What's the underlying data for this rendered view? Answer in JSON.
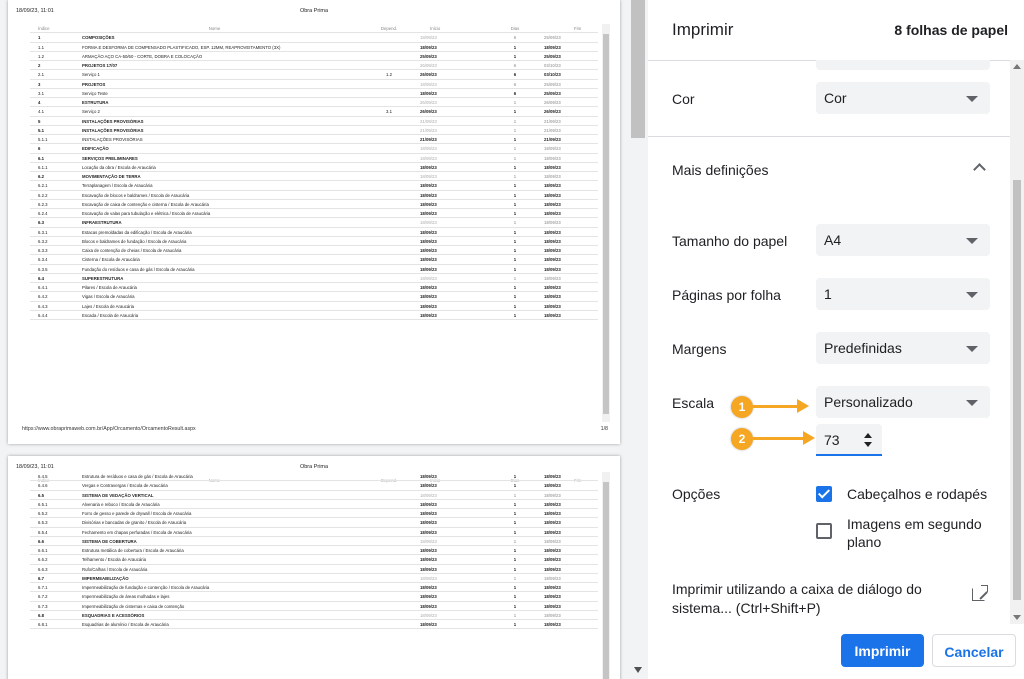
{
  "preview": {
    "page1": {
      "date": "18/09/23, 11:01",
      "title": "Obra Prima",
      "url": "https://www.obraprimaweb.com.br/App/Orcamento/OrcamentoResult.aspx",
      "page_num": "1/8",
      "headers": [
        "Índice",
        "Nome",
        "Depend.",
        "Início",
        "Dias",
        "Fim"
      ],
      "rows": [
        {
          "idx": "1",
          "name": "COMPOSIÇÕES",
          "dep": "",
          "start": "18/09/23",
          "days": "6",
          "end": "25/09/23",
          "style": "bold muted"
        },
        {
          "idx": "1.1",
          "name": "FORMA E DESFORMA DE COMPENSADO PLASTIFICADO, ESP. 12MM, REAPROVEITAMENTO (3X)",
          "dep": "",
          "start": "18/09/23",
          "days": "1",
          "end": "18/09/23",
          "style": "strong"
        },
        {
          "idx": "1.2",
          "name": "ARMAÇÃO AÇO CA-50/60 - CORTE, DOBRA E COLOCAÇÃO",
          "dep": "",
          "start": "25/09/23",
          "days": "1",
          "end": "25/09/23",
          "style": "strong"
        },
        {
          "idx": "2",
          "name": "PROJETOS 17/07",
          "dep": "",
          "start": "26/09/23",
          "days": "6",
          "end": "03/10/23",
          "style": "bold muted"
        },
        {
          "idx": "2.1",
          "name": "Serviço 1",
          "dep": "1.2",
          "start": "26/09/23",
          "days": "6",
          "end": "03/10/23",
          "style": "strong"
        },
        {
          "idx": "3",
          "name": "PROJETOS",
          "dep": "",
          "start": "18/09/23",
          "days": "6",
          "end": "25/09/23",
          "style": "bold muted"
        },
        {
          "idx": "3.1",
          "name": "Serviço Teste",
          "dep": "",
          "start": "18/09/23",
          "days": "6",
          "end": "25/09/23",
          "style": "strong"
        },
        {
          "idx": "4",
          "name": "ESTRUTURA",
          "dep": "",
          "start": "26/09/23",
          "days": "1",
          "end": "26/09/23",
          "style": "bold muted"
        },
        {
          "idx": "4.1",
          "name": "Serviço 2",
          "dep": "3.1",
          "start": "26/09/23",
          "days": "1",
          "end": "26/09/23",
          "style": "strong"
        },
        {
          "idx": "5",
          "name": "INSTALAÇÕES PROVISÓRIAS",
          "dep": "",
          "start": "21/09/23",
          "days": "1",
          "end": "21/09/23",
          "style": "bold muted"
        },
        {
          "idx": "5.1",
          "name": "INSTALAÇÕES PROVISÓRIAS",
          "dep": "",
          "start": "21/09/23",
          "days": "1",
          "end": "21/09/23",
          "style": "bold muted"
        },
        {
          "idx": "5.1.1",
          "name": "INSTALAÇÕES PROVISÓRIAS",
          "dep": "",
          "start": "21/09/23",
          "days": "1",
          "end": "21/09/23",
          "style": "strong"
        },
        {
          "idx": "6",
          "name": "EDIFICAÇÃO",
          "dep": "",
          "start": "18/09/23",
          "days": "1",
          "end": "18/09/23",
          "style": "bold muted"
        },
        {
          "idx": "6.1",
          "name": "SERVIÇOS PRELIMINARES",
          "dep": "",
          "start": "18/09/23",
          "days": "1",
          "end": "18/09/23",
          "style": "bold muted"
        },
        {
          "idx": "6.1.1",
          "name": "Locação da obra / Escola de Araucária",
          "dep": "",
          "start": "18/09/23",
          "days": "1",
          "end": "18/09/23",
          "style": "strong"
        },
        {
          "idx": "6.2",
          "name": "MOVIMENTAÇÃO DE TERRA",
          "dep": "",
          "start": "18/09/23",
          "days": "1",
          "end": "18/09/23",
          "style": "bold muted"
        },
        {
          "idx": "6.2.1",
          "name": "Terraplanagem / Escola de Araucária",
          "dep": "",
          "start": "18/09/23",
          "days": "1",
          "end": "18/09/23",
          "style": "strong"
        },
        {
          "idx": "6.2.2",
          "name": "Escavação de blocos e baldrames / Escola de Araucária",
          "dep": "",
          "start": "18/09/23",
          "days": "1",
          "end": "18/09/23",
          "style": "strong"
        },
        {
          "idx": "6.2.3",
          "name": "Escavação de caixa de contenção e cisterna / Escola de Araucária",
          "dep": "",
          "start": "18/09/23",
          "days": "1",
          "end": "18/09/23",
          "style": "strong"
        },
        {
          "idx": "6.2.4",
          "name": "Escavação de valas para tubulação e elétrica / Escola de Araucária",
          "dep": "",
          "start": "18/09/23",
          "days": "1",
          "end": "18/09/23",
          "style": "strong"
        },
        {
          "idx": "6.3",
          "name": "INFRAESTRUTURA",
          "dep": "",
          "start": "18/09/23",
          "days": "1",
          "end": "18/09/23",
          "style": "bold muted"
        },
        {
          "idx": "6.3.1",
          "name": "Estacas premoldadas da edificação / Escola de Araucária",
          "dep": "",
          "start": "18/09/23",
          "days": "1",
          "end": "18/09/23",
          "style": "strong"
        },
        {
          "idx": "6.3.2",
          "name": "Blocos e baldrames de fundação / Escola de Araucária",
          "dep": "",
          "start": "18/09/23",
          "days": "1",
          "end": "18/09/23",
          "style": "strong"
        },
        {
          "idx": "6.3.3",
          "name": "Caixa de contenção de cheias / Escola de Araucária",
          "dep": "",
          "start": "18/09/23",
          "days": "1",
          "end": "18/09/23",
          "style": "strong"
        },
        {
          "idx": "6.3.4",
          "name": "Cisterna / Escola de Araucária",
          "dep": "",
          "start": "18/09/23",
          "days": "1",
          "end": "18/09/23",
          "style": "strong"
        },
        {
          "idx": "6.3.5",
          "name": "Fundação do resíduos e casa de gás / Escola de Araucária",
          "dep": "",
          "start": "18/09/23",
          "days": "1",
          "end": "18/09/23",
          "style": "strong"
        },
        {
          "idx": "6.4",
          "name": "SUPERESTRUTURA",
          "dep": "",
          "start": "18/09/23",
          "days": "1",
          "end": "18/09/23",
          "style": "bold muted"
        },
        {
          "idx": "6.4.1",
          "name": "Pilares / Escola de Araucária",
          "dep": "",
          "start": "18/09/23",
          "days": "1",
          "end": "18/09/23",
          "style": "strong"
        },
        {
          "idx": "6.4.2",
          "name": "Vigas / Escola de Araucária",
          "dep": "",
          "start": "18/09/23",
          "days": "1",
          "end": "18/09/23",
          "style": "strong"
        },
        {
          "idx": "6.4.3",
          "name": "Lajes / Escola de Araucária",
          "dep": "",
          "start": "18/09/23",
          "days": "1",
          "end": "18/09/23",
          "style": "strong"
        },
        {
          "idx": "6.4.4",
          "name": "Escada / Escola de Araucária",
          "dep": "",
          "start": "18/09/23",
          "days": "1",
          "end": "18/09/23",
          "style": "strong"
        }
      ]
    },
    "page2": {
      "date": "18/09/23, 11:01",
      "title": "Obra Prima",
      "headers": [
        "Índice",
        "Nome",
        "Depend.",
        "Início",
        "Dias",
        "Fim"
      ],
      "rows": [
        {
          "idx": "6.4.5",
          "name": "Estrutura de resíduos e casa de gás / Escola de Araucária",
          "dep": "",
          "start": "18/09/23",
          "days": "1",
          "end": "18/09/23",
          "style": "strong"
        },
        {
          "idx": "6.4.6",
          "name": "Vergas e Contravergas / Escola de Araucária",
          "dep": "",
          "start": "18/09/23",
          "days": "1",
          "end": "18/09/23",
          "style": "strong"
        },
        {
          "idx": "6.5",
          "name": "SISTEMA DE VEDAÇÃO VERTICAL",
          "dep": "",
          "start": "18/09/23",
          "days": "1",
          "end": "18/09/23",
          "style": "bold muted"
        },
        {
          "idx": "6.5.1",
          "name": "Alvenaria e reboco / Escola de Araucária",
          "dep": "",
          "start": "18/09/23",
          "days": "1",
          "end": "18/09/23",
          "style": "strong"
        },
        {
          "idx": "6.5.2",
          "name": "Forro de gesso e parede de drywall / Escola de Araucária",
          "dep": "",
          "start": "18/09/23",
          "days": "1",
          "end": "18/09/23",
          "style": "strong"
        },
        {
          "idx": "6.5.3",
          "name": "Divisórias e bancadas de granito / Escola de Araucária",
          "dep": "",
          "start": "18/09/23",
          "days": "1",
          "end": "18/09/23",
          "style": "strong"
        },
        {
          "idx": "6.5.4",
          "name": "Fechamento em chapas perfuradas / Escola de Araucária",
          "dep": "",
          "start": "18/09/23",
          "days": "1",
          "end": "18/09/23",
          "style": "strong"
        },
        {
          "idx": "6.6",
          "name": "SISTEMA DE COBERTURA",
          "dep": "",
          "start": "18/09/23",
          "days": "1",
          "end": "18/09/23",
          "style": "bold muted"
        },
        {
          "idx": "6.6.1",
          "name": "Estrutura metálica de cobertura / Escola de Araucária",
          "dep": "",
          "start": "18/09/23",
          "days": "1",
          "end": "18/09/23",
          "style": "strong"
        },
        {
          "idx": "6.6.2",
          "name": "Telhamento / Escola de Araucária",
          "dep": "",
          "start": "18/09/23",
          "days": "1",
          "end": "18/09/23",
          "style": "strong"
        },
        {
          "idx": "6.6.3",
          "name": "Rufo/Calhas / Escola de Araucária",
          "dep": "",
          "start": "18/09/23",
          "days": "1",
          "end": "18/09/23",
          "style": "strong"
        },
        {
          "idx": "6.7",
          "name": "IMPERMEABILIZAÇÃO",
          "dep": "",
          "start": "18/09/23",
          "days": "1",
          "end": "18/09/23",
          "style": "bold muted"
        },
        {
          "idx": "6.7.1",
          "name": "Impermeabilização de fundação e contenção / Escola de Araucária",
          "dep": "",
          "start": "18/09/23",
          "days": "1",
          "end": "18/09/23",
          "style": "strong"
        },
        {
          "idx": "6.7.2",
          "name": "Impermeabilização de áreas molhadas e lajes",
          "dep": "",
          "start": "18/09/23",
          "days": "1",
          "end": "18/09/23",
          "style": "strong"
        },
        {
          "idx": "6.7.3",
          "name": "Impermeabilização de cisternas e caixa de contenção",
          "dep": "",
          "start": "18/09/23",
          "days": "1",
          "end": "18/09/23",
          "style": "strong"
        },
        {
          "idx": "6.8",
          "name": "ESQUADRIAS E ACESSÓRIOS",
          "dep": "",
          "start": "18/09/23",
          "days": "1",
          "end": "18/09/23",
          "style": "bold muted"
        },
        {
          "idx": "6.8.1",
          "name": "Esquadrias de alumínio / Escola de Araucária",
          "dep": "",
          "start": "18/09/23",
          "days": "1",
          "end": "18/09/23",
          "style": "strong"
        }
      ]
    }
  },
  "panel": {
    "title": "Imprimir",
    "sheet_count": "8 folhas de papel",
    "color": {
      "label": "Cor",
      "value": "Cor"
    },
    "more_settings": {
      "label": "Mais definições"
    },
    "paper_size": {
      "label": "Tamanho do papel",
      "value": "A4"
    },
    "pages_per_sheet": {
      "label": "Páginas por folha",
      "value": "1"
    },
    "margins": {
      "label": "Margens",
      "value": "Predefinidas"
    },
    "scale": {
      "label": "Escala",
      "value": "Personalizado",
      "custom_value": "73"
    },
    "options": {
      "label": "Opções",
      "headers_footers": {
        "label": "Cabeçalhos e rodapés",
        "checked": true
      },
      "background_images": {
        "label": "Imagens em segundo plano",
        "checked": false
      }
    },
    "system_dialog": {
      "label": "Imprimir utilizando a caixa de diálogo do sistema... (Ctrl+Shift+P)",
      "icon": "open-in-new-icon"
    },
    "buttons": {
      "print": "Imprimir",
      "cancel": "Cancelar"
    }
  },
  "annotations": {
    "badge1": "1",
    "badge2": "2",
    "color": "#f5a623"
  },
  "colors": {
    "accent": "#1a73e8",
    "select_bg": "#f1f3f4",
    "text": "#202124"
  }
}
